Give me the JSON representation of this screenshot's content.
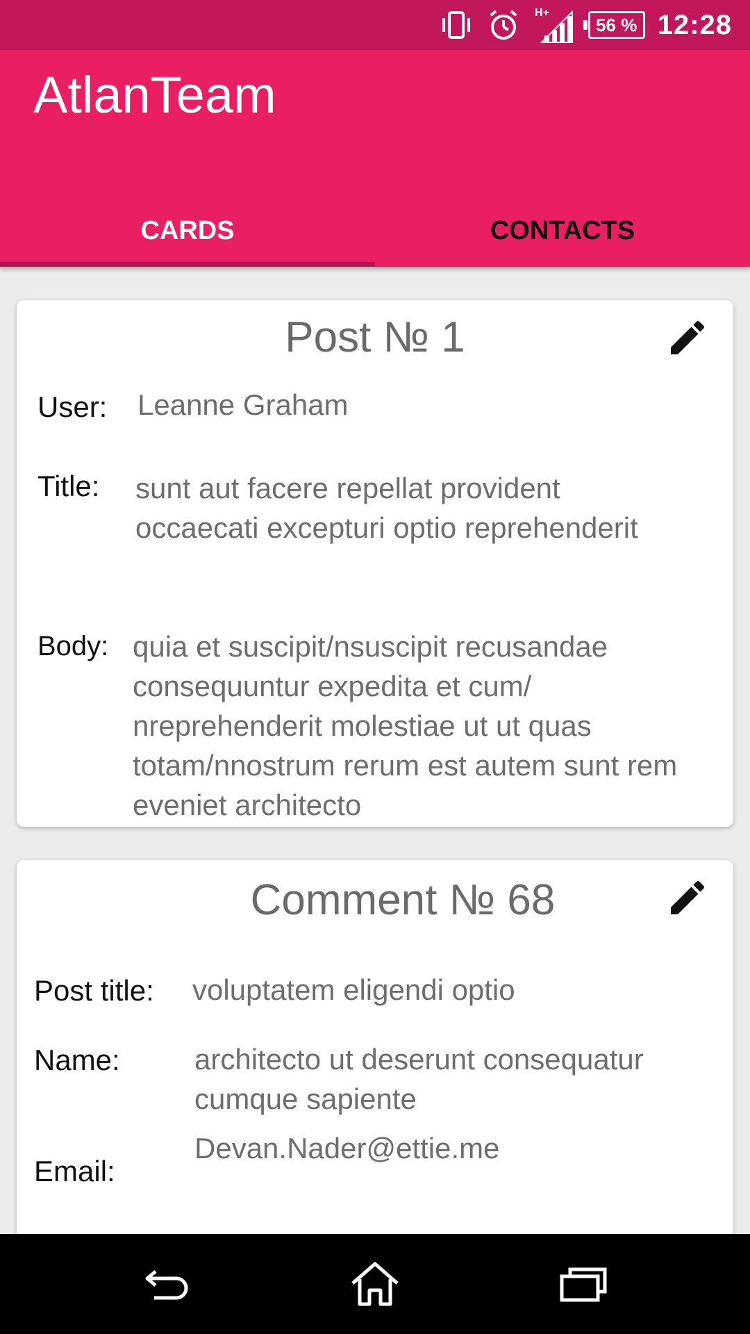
{
  "status_bar": {
    "battery": "56 %",
    "time": "12:28",
    "icons": [
      "vibrate-icon",
      "alarm-icon",
      "signal-h-plus-icon",
      "battery-icon"
    ]
  },
  "app": {
    "title": "AtlanTeam"
  },
  "tabs": [
    {
      "label": "CARDS",
      "active": true
    },
    {
      "label": "CONTACTS",
      "active": false
    }
  ],
  "colors": {
    "primary": "#e91e63",
    "primary_dark": "#c2185b",
    "text_secondary": "#6d6d6d"
  },
  "cards": [
    {
      "title": "Post № 1",
      "fields": {
        "user_label": "User:",
        "user_value": "Leanne Graham",
        "title_label": "Title:",
        "title_value": "sunt aut facere repellat provident occaecati excepturi optio reprehenderit",
        "body_label": "Body:",
        "body_value": "quia et suscipit/nsuscipit recusandae consequuntur expedita et cum/ nreprehenderit molestiae ut ut quas totam/nnostrum rerum est autem sunt rem eveniet architecto"
      }
    },
    {
      "title": "Comment № 68",
      "fields": {
        "post_title_label": "Post title:",
        "post_title_value": "voluptatem eligendi optio",
        "name_label": "Name:",
        "name_value": "architecto ut deserunt consequatur cumque sapiente",
        "email_label": "Email:",
        "email_value": "Devan.Nader@ettie.me"
      }
    }
  ],
  "nav": {
    "icons": [
      "back-icon",
      "home-icon",
      "recents-icon"
    ]
  }
}
